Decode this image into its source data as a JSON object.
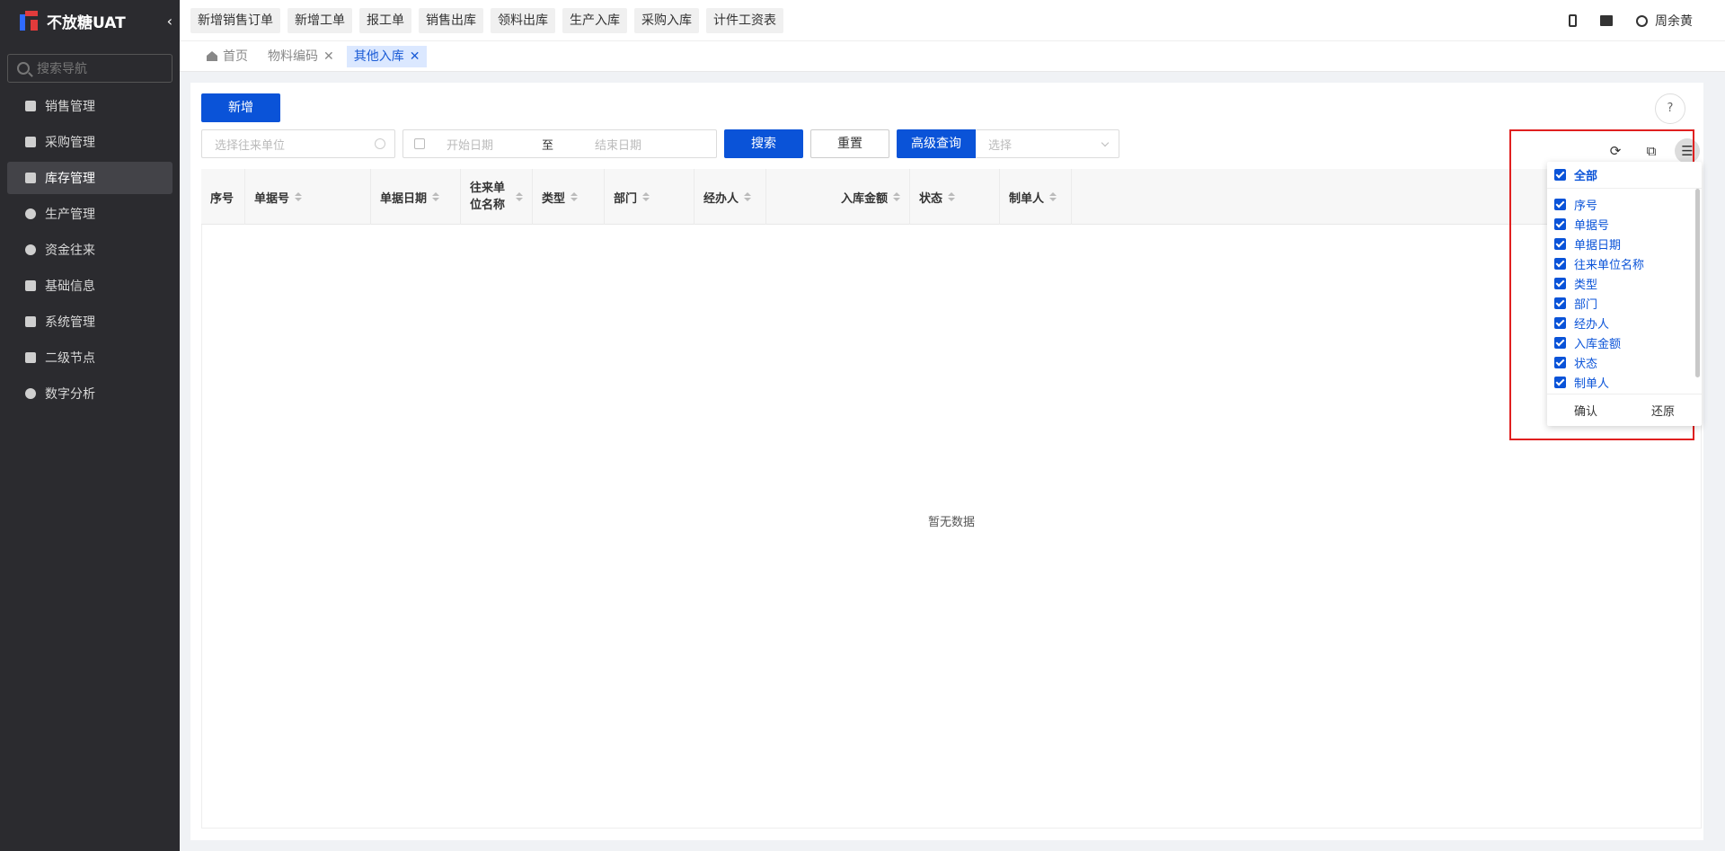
{
  "app": {
    "name": "不放糖UAT",
    "collapse_glyph": "‹"
  },
  "sidebar": {
    "search_placeholder": "搜索导航",
    "items": [
      {
        "label": "销售管理",
        "icon": "tag-icon"
      },
      {
        "label": "采购管理",
        "icon": "cart-icon"
      },
      {
        "label": "库存管理",
        "icon": "warehouse-icon",
        "active": true
      },
      {
        "label": "生产管理",
        "icon": "production-icon"
      },
      {
        "label": "资金往来",
        "icon": "money-icon"
      },
      {
        "label": "基础信息",
        "icon": "grid-icon"
      },
      {
        "label": "系统管理",
        "icon": "apps-icon"
      },
      {
        "label": "二级节点",
        "icon": "doc-icon"
      },
      {
        "label": "数字分析",
        "icon": "pie-icon"
      }
    ]
  },
  "topbar": {
    "quick_links": [
      "新增销售订单",
      "新增工单",
      "报工单",
      "销售出库",
      "领料出库",
      "生产入库",
      "采购入库",
      "计件工资表"
    ],
    "user": "周余黄"
  },
  "tabs": [
    {
      "label": "首页",
      "closable": false
    },
    {
      "label": "物料编码",
      "closable": true
    },
    {
      "label": "其他入库",
      "closable": true,
      "active": true
    }
  ],
  "toolbar": {
    "add_label": "新增",
    "help_glyph": "?",
    "unit_placeholder": "选择往来单位",
    "start_date_placeholder": "开始日期",
    "date_sep": "至",
    "end_date_placeholder": "结束日期",
    "search_label": "搜索",
    "reset_label": "重置",
    "advanced_label": "高级查询",
    "select_placeholder": "选择",
    "refresh_glyph": "⟳",
    "export_glyph": "⧉",
    "settings_glyph": "☰"
  },
  "table": {
    "columns": [
      "序号",
      "单据号",
      "单据日期",
      "往来单位名称",
      "类型",
      "部门",
      "经办人",
      "入库金额",
      "状态",
      "制单人"
    ],
    "empty_text": "暂无数据"
  },
  "column_panel": {
    "all_label": "全部",
    "items": [
      "序号",
      "单据号",
      "单据日期",
      "往来单位名称",
      "类型",
      "部门",
      "经办人",
      "入库金额",
      "状态",
      "制单人"
    ],
    "confirm_label": "确认",
    "restore_label": "还原"
  }
}
